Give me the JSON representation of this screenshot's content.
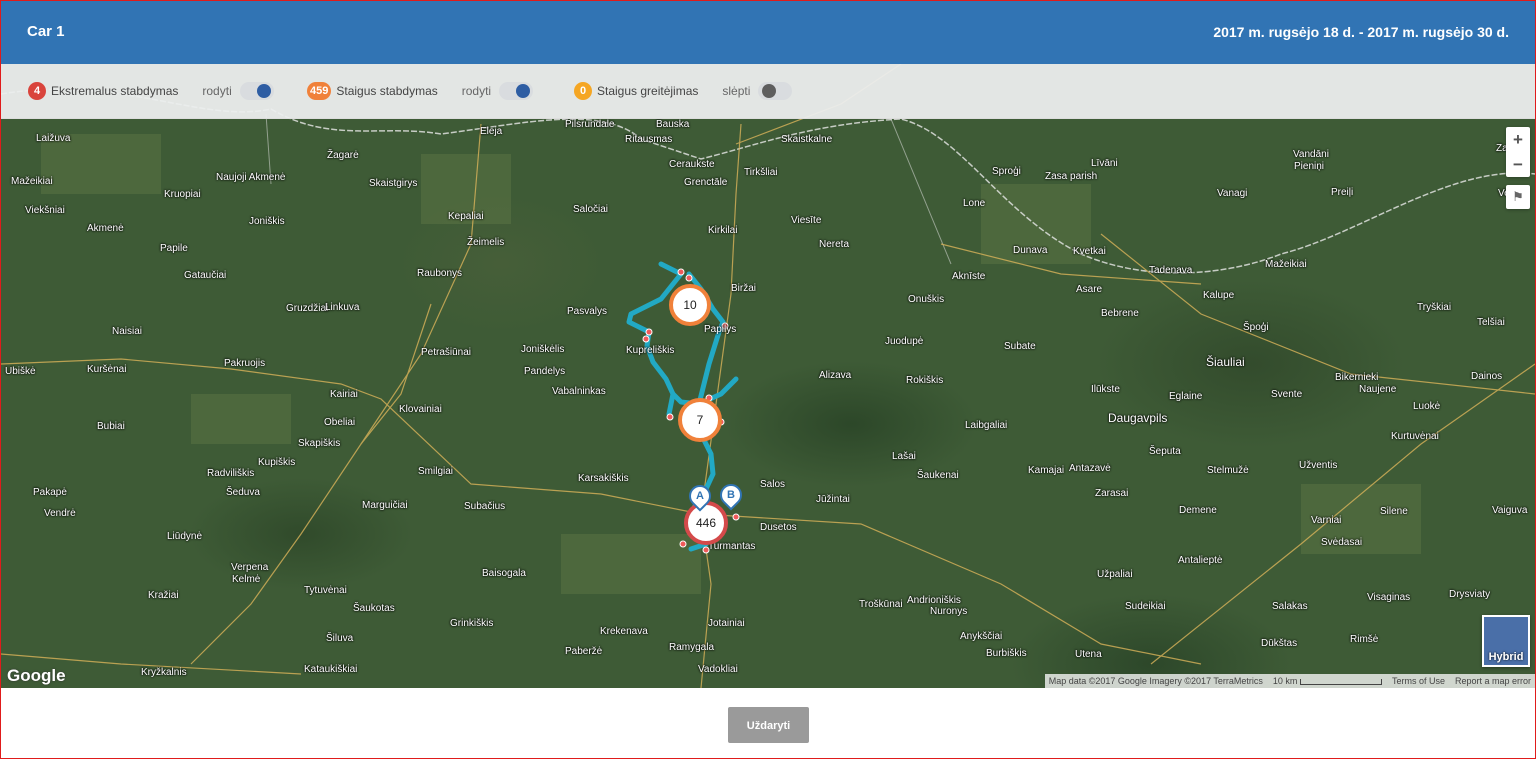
{
  "header": {
    "title": "Car 1",
    "date_range": "2017 m. rugsėjo 18 d. - 2017 m. rugsėjo 30 d."
  },
  "filters": [
    {
      "count": "4",
      "label": "Ekstremalus stabdymas",
      "state": "rodyti",
      "on": true,
      "color": "#d9443c"
    },
    {
      "count": "459",
      "label": "Staigus stabdymas",
      "state": "rodyti",
      "on": true,
      "color": "#f0813a"
    },
    {
      "count": "0",
      "label": "Staigus greitėjimas",
      "state": "slėpti",
      "on": false,
      "color": "#f5a623"
    }
  ],
  "map": {
    "type": "Hybrid",
    "clusters": [
      "10",
      "7",
      "446"
    ],
    "markers": [
      "A",
      "B"
    ],
    "route_color": "#22a9c4",
    "places": [
      "Laižuva",
      "Mažeikiai",
      "Naujoji Akmenė",
      "Žagarė",
      "Skaistgirys",
      "Eleja",
      "Pilsrundale",
      "Bauska",
      "Ritausmas",
      "Skaistkalne",
      "Ceraukste",
      "Grenctāle",
      "Tirkšliai",
      "Viekšniai",
      "Akmenė",
      "Kruopiai",
      "Joniškis",
      "Kepaliai",
      "Žeimelis",
      "Saločiai",
      "Kirkilai",
      "Viesīte",
      "Līvāni",
      "Vandāni",
      "Pieniņi",
      "Zalve",
      "Sproģi",
      "Lone",
      "Zasa parish",
      "Vanagi",
      "Preiļi",
      "Venta",
      "Papile",
      "Gataučiai",
      "Raubonys",
      "Biržai",
      "Nereta",
      "Dunava",
      "Kvetkai",
      "Aknīste",
      "Tadenava",
      "Mažeikiai",
      "Gruzdžiai",
      "Linkuva",
      "Pasvalys",
      "Papilys",
      "Onuškis",
      "Asare",
      "Kalupe",
      "Tryškiai",
      "Naisiai",
      "Petrašiūnai",
      "Joniškėlis",
      "Kupreliškis",
      "Juodupė",
      "Bebrene",
      "Špoģi",
      "Telšiai",
      "Ubiškė",
      "Kuršėnai",
      "Pakruojis",
      "Pandelys",
      "Subate",
      "Šiauliai",
      "Kairiai",
      "Klovainiai",
      "Vabalninkas",
      "Alizava",
      "Rokiškis",
      "Ilūkste",
      "Bikernieki",
      "Dainos",
      "Obeliai",
      "Eglaine",
      "Svente",
      "Naujene",
      "Luokė",
      "Bubiai",
      "Skapiškis",
      "Laibgaliai",
      "Daugavpils",
      "Kurtuvėnai",
      "Kupiškis",
      "Lašai",
      "Šeputa",
      "Šaukenai",
      "Radviliškis",
      "Smilgiai",
      "Karsakiškis",
      "Salos",
      "Kamajai",
      "Antazavė",
      "Stelmužė",
      "Užventis",
      "Pakapė",
      "Šeduva",
      "Subačius",
      "Jūžintai",
      "Zarasai",
      "Varniai",
      "Vendrė",
      "Marguičiai",
      "Dusetos",
      "Demene",
      "Silene",
      "Vaiguva",
      "Liūdynė",
      "Turmantas",
      "Svėdasai",
      "Verpena",
      "Kelmė",
      "Baisogala",
      "Užpaliai",
      "Antalieptė",
      "Tytuvėnai",
      "Kražiai",
      "Šaukotas",
      "Andrioniškis",
      "Nuronys",
      "Troškūnai",
      "Sudeikiai",
      "Salakas",
      "Visaginas",
      "Drysviaty",
      "Grinkiškis",
      "Krekenava",
      "Jotainiai",
      "Anykščiai",
      "Dūkštas",
      "Rimšė",
      "Šiluva",
      "Kataukiškiai",
      "Paberžė",
      "Ramygala",
      "Vadokliai",
      "Burbiškis",
      "Utena",
      "Kryžkalnis"
    ],
    "zoom_in": "+",
    "zoom_out": "−",
    "google_logo": "Google",
    "attribution": "Map data ©2017 Google Imagery ©2017 TerraMetrics",
    "scale": "10 km",
    "terms": "Terms of Use",
    "report": "Report a map error"
  },
  "footer": {
    "close_label": "Uždaryti"
  }
}
